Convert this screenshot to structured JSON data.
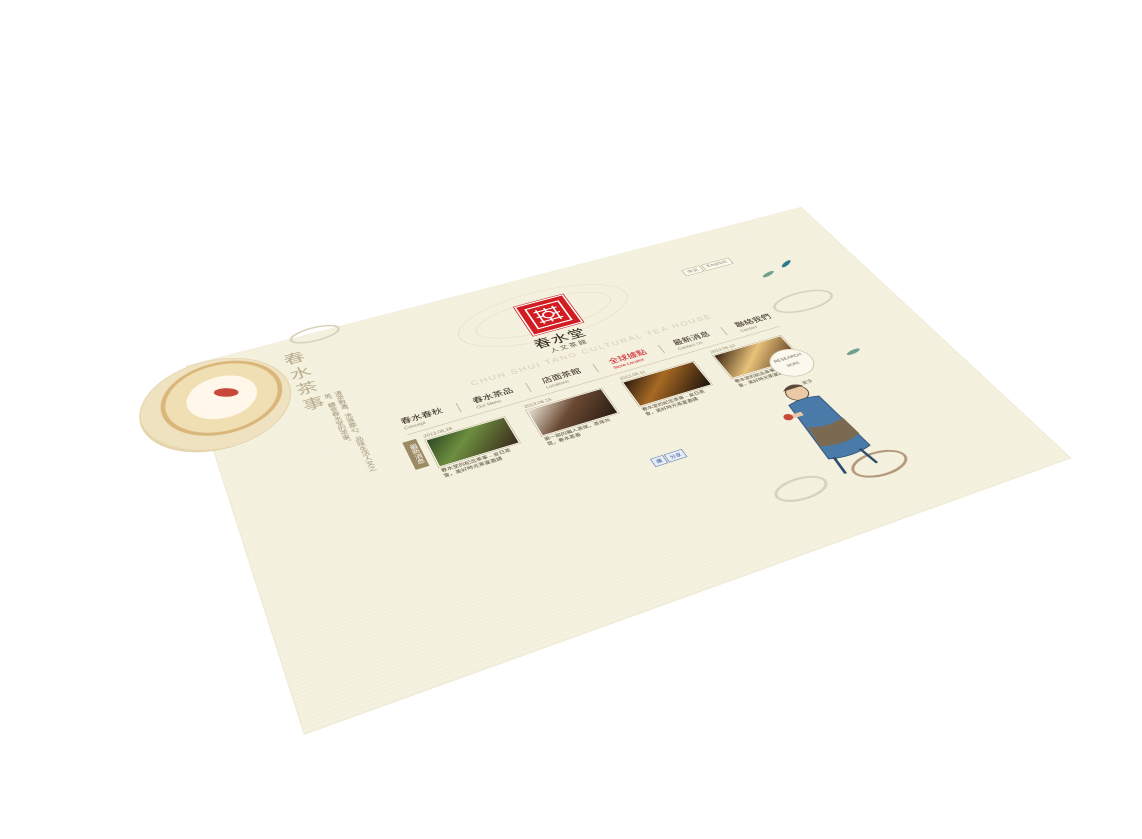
{
  "site": {
    "vertical_title": "春水茶事",
    "vertical_text": "清茶數盞，洗滌塵心，品味生活人文之美，體會春水堂的茶事。",
    "logo_name": "春水堂",
    "logo_sub": "人文茶館",
    "english_name": "CHUN SHUI TANG CULTURAL TEA HOUSE"
  },
  "language": {
    "items": [
      {
        "label": "中文"
      },
      {
        "label": "English"
      }
    ]
  },
  "nav": {
    "items": [
      {
        "zh": "春水春秋",
        "en": "Concept",
        "active": false
      },
      {
        "zh": "春水茶品",
        "en": "Our Menu",
        "active": false
      },
      {
        "zh": "店面茶館",
        "en": "Locations",
        "active": false
      },
      {
        "zh": "全球據點",
        "en": "Store Locator",
        "active": true
      },
      {
        "zh": "最新消息",
        "en": "Contact Us",
        "active": false
      },
      {
        "zh": "聯絡我們",
        "en": "Contact",
        "active": false
      }
    ]
  },
  "news": {
    "badge": "最新消息",
    "items": [
      {
        "date": "2013.06.26",
        "title": "春水堂的紀念茶事 - 夏日茶會，美好時光茶宴邀請"
      },
      {
        "date": "2013.06.15",
        "title": "第一屆的職人茶席，茶席共賞，春水茶香"
      },
      {
        "date": "2013.06.11",
        "title": "春水堂的紀念茶事 - 夏日茶會，美好時光茶宴邀請"
      },
      {
        "date": "2013.06.10",
        "title": "春水堂的紀念茶事 - 夏日茶會，美好時光茶宴邀請"
      }
    ]
  },
  "more_button": {
    "label": "RESEARCH",
    "sub": "MORE"
  },
  "pager": {
    "label": "更多"
  },
  "social": {
    "items": [
      {
        "label": "讚"
      },
      {
        "label": "分享"
      }
    ]
  },
  "colors": {
    "background": "#f6f2e0",
    "accent": "#c8121e",
    "text": "#2d2417"
  }
}
